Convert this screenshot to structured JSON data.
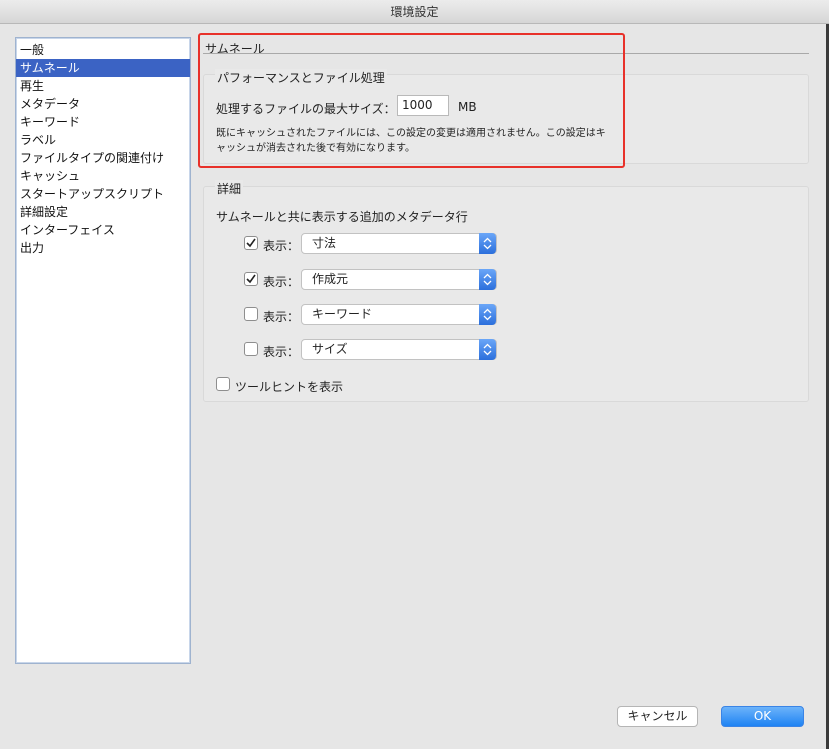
{
  "window": {
    "title": "環境設定"
  },
  "sidebar": {
    "items": [
      {
        "label": "一般",
        "selected": false
      },
      {
        "label": "サムネール",
        "selected": true
      },
      {
        "label": "再生",
        "selected": false
      },
      {
        "label": "メタデータ",
        "selected": false
      },
      {
        "label": "キーワード",
        "selected": false
      },
      {
        "label": "ラベル",
        "selected": false
      },
      {
        "label": "ファイルタイプの関連付け",
        "selected": false
      },
      {
        "label": "キャッシュ",
        "selected": false
      },
      {
        "label": "スタートアップスクリプト",
        "selected": false
      },
      {
        "label": "詳細設定",
        "selected": false
      },
      {
        "label": "インターフェイス",
        "selected": false
      },
      {
        "label": "出力",
        "selected": false
      }
    ]
  },
  "pane": {
    "title": "サムネール",
    "performance": {
      "heading": "パフォーマンスとファイル処理",
      "max_size_label": "処理するファイルの最大サイズ：",
      "max_size_value": "1000",
      "max_size_unit": "MB",
      "note_line1": "既にキャッシュされたファイルには、この設定の変更は適用されません。この設定はキ",
      "note_line2": "ャッシュが消去された後で有効になります。"
    },
    "details": {
      "heading": "詳細",
      "metadata_label": "サムネールと共に表示する追加のメタデータ行",
      "show_label": "表示：",
      "rows": [
        {
          "checked": true,
          "value": "寸法"
        },
        {
          "checked": true,
          "value": "作成元"
        },
        {
          "checked": false,
          "value": "キーワード"
        },
        {
          "checked": false,
          "value": "サイズ"
        }
      ],
      "tooltip_label": "ツールヒントを表示",
      "tooltip_checked": false
    }
  },
  "buttons": {
    "cancel": "キャンセル",
    "ok": "OK"
  },
  "colors": {
    "accent": "#1f83f3",
    "selection": "#3b63c4",
    "highlight": "#e8312a"
  }
}
